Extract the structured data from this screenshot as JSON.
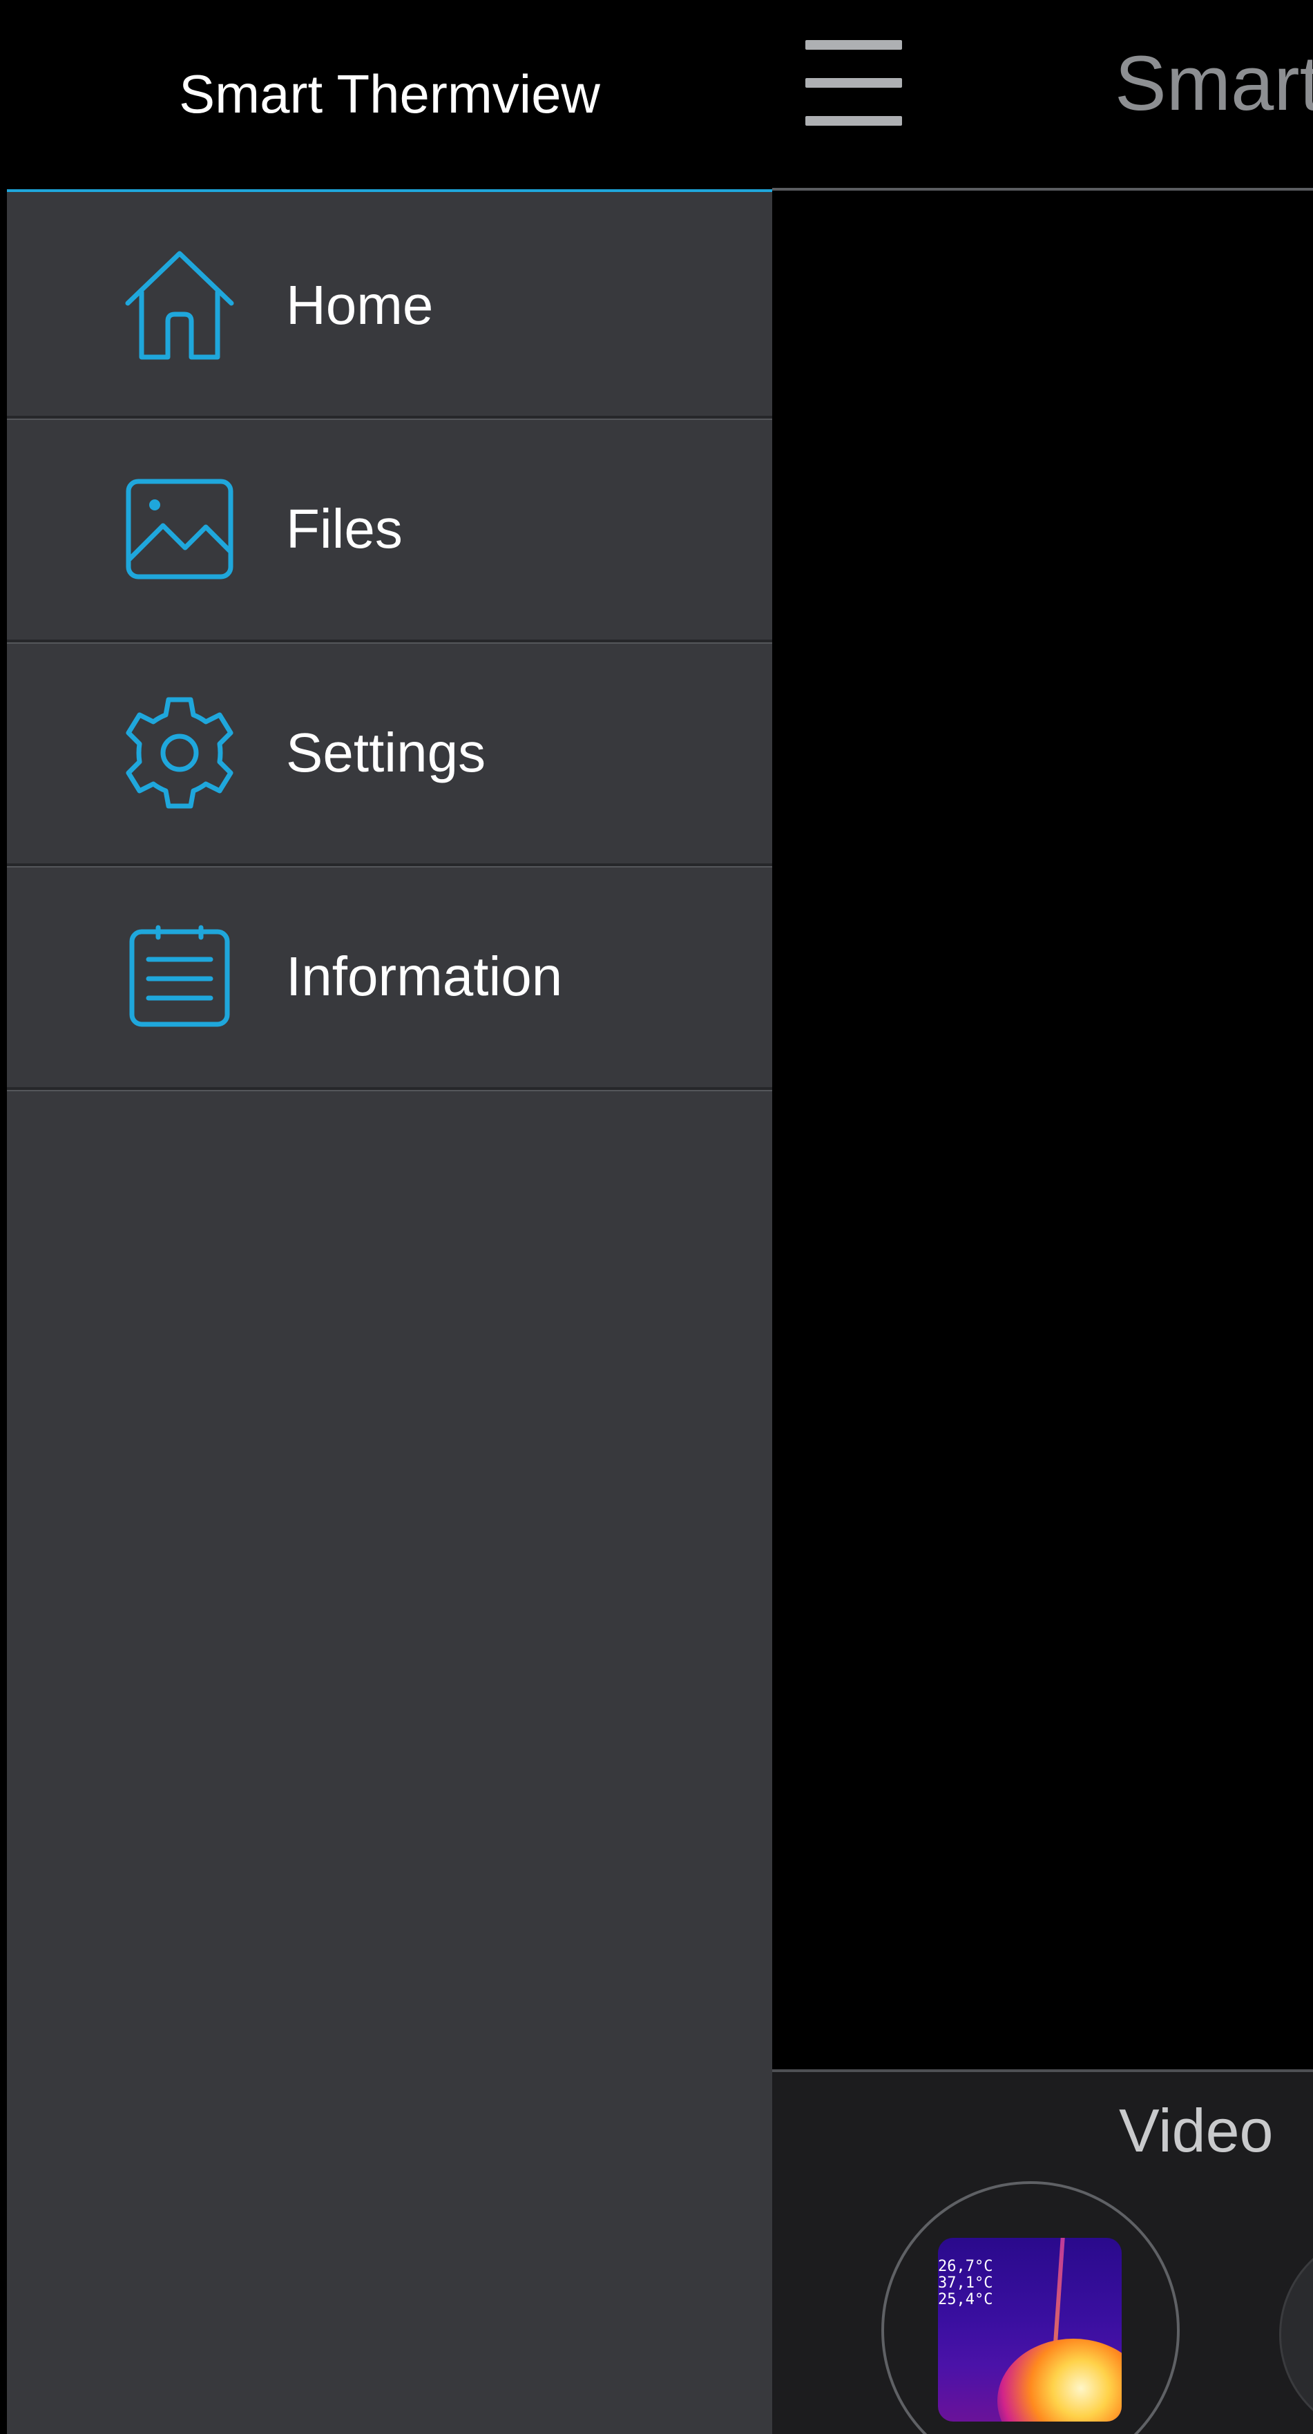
{
  "app": {
    "title": "Smart Thermview",
    "mode_label": "Video",
    "thumbnail_temps": [
      "26,7°C",
      "37,1°C",
      "25,4°C"
    ]
  },
  "drawer": {
    "title": "Smart Thermview",
    "items": [
      {
        "label": "Home",
        "icon": "home-icon"
      },
      {
        "label": "Files",
        "icon": "image-icon"
      },
      {
        "label": "Settings",
        "icon": "gear-icon"
      },
      {
        "label": "Information",
        "icon": "notepad-icon"
      }
    ]
  },
  "colors": {
    "accent": "#1fa7dc",
    "drawer_bg": "#38393d",
    "header_bg": "#000000"
  }
}
